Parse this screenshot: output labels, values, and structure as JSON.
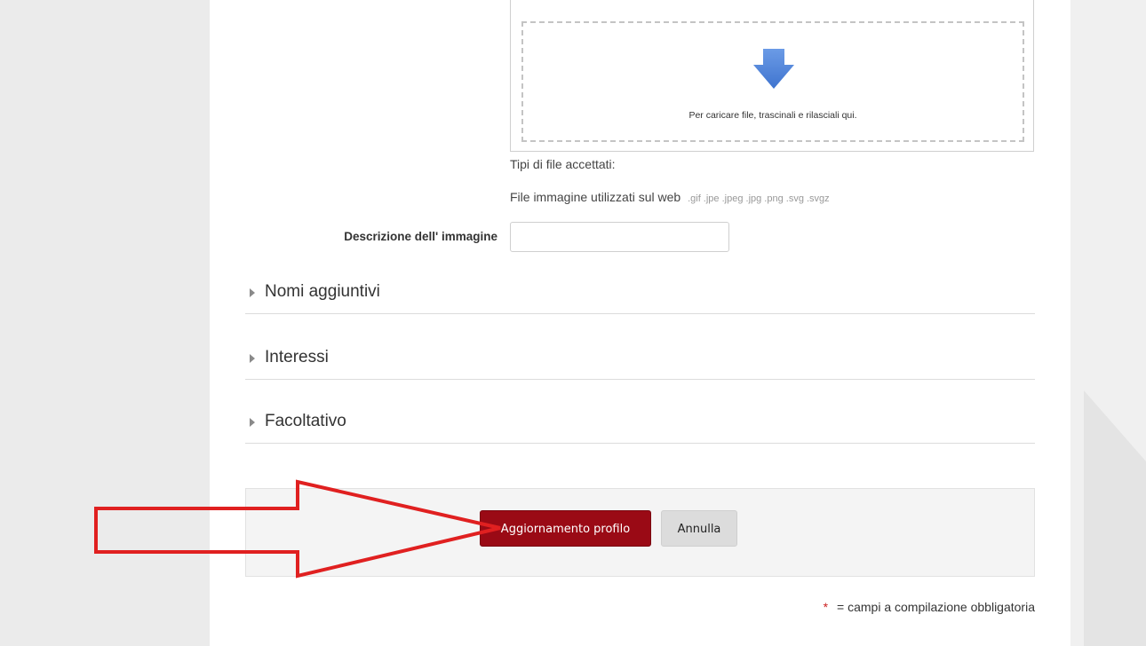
{
  "filepicker": {
    "drop_text": "Per caricare file, trascinali e rilasciali qui.",
    "accepted_label": "Tipi di file accettati:",
    "accepted_types_label": "File immagine utilizzati sul web",
    "accepted_extensions": ".gif .jpe .jpeg .jpg .png .svg .svgz"
  },
  "image_description": {
    "label": "Descrizione dell' immagine",
    "value": "",
    "placeholder": ""
  },
  "sections": [
    {
      "label": "Nomi aggiuntivi"
    },
    {
      "label": "Interessi"
    },
    {
      "label": "Facoltativo"
    }
  ],
  "actions": {
    "submit_label": "Aggiornamento profilo",
    "cancel_label": "Annulla"
  },
  "required_note": {
    "star": "*",
    "text": "= campi a compilazione obbligatoria"
  },
  "colors": {
    "primary_button": "#9a0a15",
    "annotation_arrow": "#e02020",
    "drop_arrow": "#5b8ee0"
  },
  "icons": {
    "drop_arrow": "down-arrow-icon",
    "section_caret": "caret-right-icon",
    "annotation": "right-arrow-annotation"
  }
}
